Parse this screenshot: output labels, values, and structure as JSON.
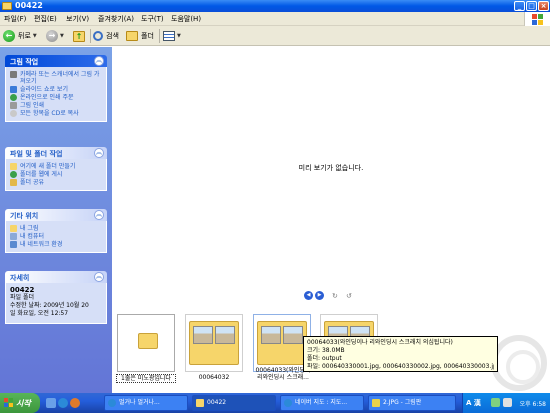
{
  "window": {
    "title": "00422"
  },
  "menu": [
    "파일(F)",
    "편집(E)",
    "보기(V)",
    "즐겨찾기(A)",
    "도구(T)",
    "도움말(H)"
  ],
  "toolbar": {
    "back_label": "뒤로",
    "search_label": "검색",
    "folders_label": "폴더"
  },
  "sidebar": {
    "picture_tasks": {
      "title": "그림 작업",
      "items": [
        "카메라 또는 스캐너에서 그림 가져오기",
        "슬라이드 쇼로 보기",
        "온라인으로 인쇄 주문",
        "그림 인쇄",
        "모든 항목을 CD로 복사"
      ]
    },
    "file_tasks": {
      "title": "파일 및 폴더 작업",
      "items": [
        "여기에 새 폴더 만들기",
        "폴더를 웹에 게시",
        "폴더 공유"
      ]
    },
    "other_places": {
      "title": "기타 위치",
      "items": [
        "내 그림",
        "내 컴퓨터",
        "내 네트워크 환경"
      ]
    },
    "details": {
      "title": "자세히",
      "name": "00422",
      "type": "파일 폴더",
      "modified_line1": "수정한 날짜: 2009년 10월 20",
      "modified_line2": "일 화요일, 오전 12:57"
    }
  },
  "viewer": {
    "no_preview": "미리 보기가 없습니다."
  },
  "filmstrip": [
    {
      "caption_line1": "1출은 미노광입니다",
      "caption_line2": ""
    },
    {
      "caption_line1": "00064032",
      "caption_line2": ""
    },
    {
      "caption_line1": "00064033(와인딩이",
      "caption_line2": "리와인딩시 스크래..."
    },
    {
      "caption_line1": "",
      "caption_line2": ""
    }
  ],
  "tooltip": {
    "line1": "00064033(와인딩이나 리와인딩시 스크래치 의심됩니다)",
    "line2": "크기: 38.0MB",
    "line3": "폴더: output",
    "line4": "파일: 000640330001.jpg, 000640330002.jpg, 000640330003.jpg, ..."
  },
  "taskbar": {
    "start_label": "시작",
    "buttons": [
      "멀거나 멀거나...",
      "00422",
      "네이버 지도 : 지도...",
      "2.JPG - 그림판"
    ],
    "lang": "A 漢",
    "clock": "오후 6:58"
  },
  "colors": {
    "accent": "#0058e6",
    "sidebar": "#7ba2e7",
    "task_text": "#215dc6",
    "start_button": "#3c963c",
    "tooltip_bg": "#ffffe1"
  }
}
